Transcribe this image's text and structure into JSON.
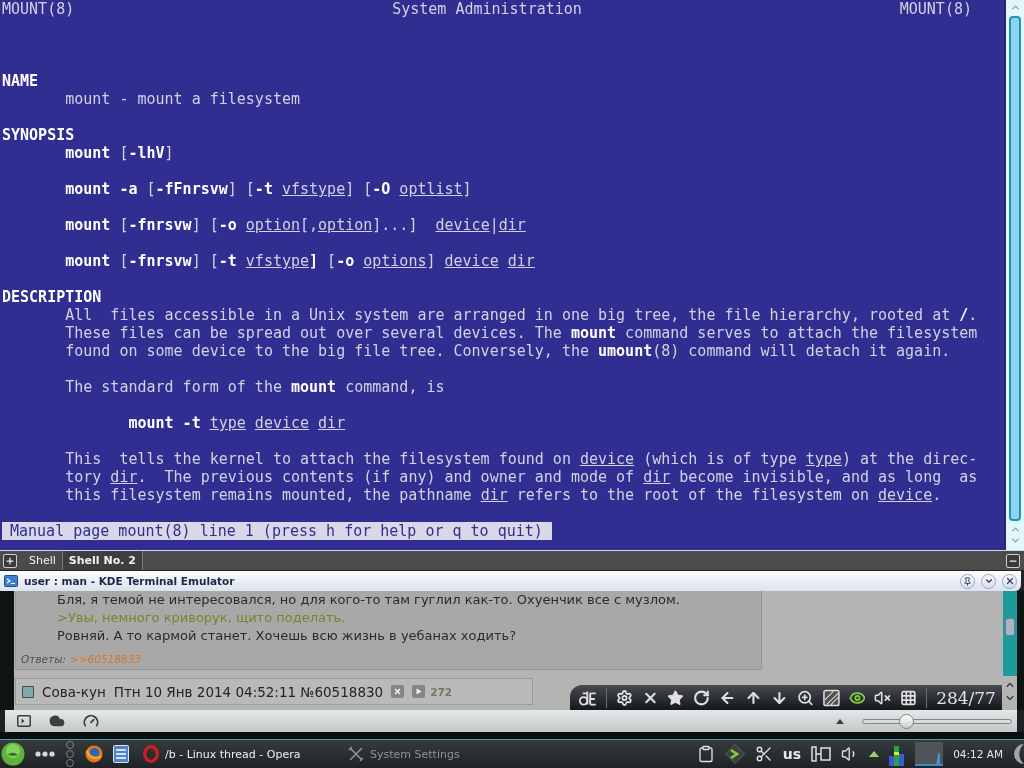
{
  "terminal": {
    "header": {
      "left": "MOUNT(8)",
      "center": "System Administration",
      "right": "MOUNT(8)"
    },
    "sections": [
      {
        "title": "NAME",
        "paragraphs": [
          {
            "kind": "text",
            "lines": [
              [
                {
                  "text": "mount - mount a filesystem",
                  "kind": "normal"
                }
              ]
            ]
          }
        ]
      },
      {
        "title": "SYNOPSIS",
        "paragraphs": [
          {
            "kind": "text",
            "lines": [
              [
                {
                  "text": "mount",
                  "kind": "bold"
                },
                {
                  "text": " [",
                  "kind": "normal"
                },
                {
                  "text": "-lhV",
                  "kind": "bold"
                },
                {
                  "text": "]",
                  "kind": "normal"
                }
              ]
            ]
          },
          {
            "kind": "text",
            "lines": [
              [
                {
                  "text": "mount -a",
                  "kind": "bold"
                },
                {
                  "text": " [",
                  "kind": "normal"
                },
                {
                  "text": "-fFnrsvw",
                  "kind": "bold"
                },
                {
                  "text": "] [",
                  "kind": "normal"
                },
                {
                  "text": "-t ",
                  "kind": "bold"
                },
                {
                  "text": "vfstype",
                  "kind": "underline"
                },
                {
                  "text": "] [",
                  "kind": "normal"
                },
                {
                  "text": "-O ",
                  "kind": "bold"
                },
                {
                  "text": "optlist",
                  "kind": "underline"
                },
                {
                  "text": "]",
                  "kind": "normal"
                }
              ]
            ]
          },
          {
            "kind": "text",
            "lines": [
              [
                {
                  "text": "mount",
                  "kind": "bold"
                },
                {
                  "text": " [",
                  "kind": "normal"
                },
                {
                  "text": "-fnrsvw",
                  "kind": "bold"
                },
                {
                  "text": "] [",
                  "kind": "normal"
                },
                {
                  "text": "-o ",
                  "kind": "bold"
                },
                {
                  "text": "option",
                  "kind": "underline"
                },
                {
                  "text": "[,",
                  "kind": "normal"
                },
                {
                  "text": "option",
                  "kind": "underline"
                },
                {
                  "text": "]...]  ",
                  "kind": "normal"
                },
                {
                  "text": "device",
                  "kind": "underline"
                },
                {
                  "text": "|",
                  "kind": "normal"
                },
                {
                  "text": "dir",
                  "kind": "underline"
                }
              ]
            ]
          },
          {
            "kind": "text",
            "lines": [
              [
                {
                  "text": "mount",
                  "kind": "bold"
                },
                {
                  "text": " [",
                  "kind": "normal"
                },
                {
                  "text": "-fnrsvw",
                  "kind": "bold"
                },
                {
                  "text": "] [",
                  "kind": "normal"
                },
                {
                  "text": "-t ",
                  "kind": "bold"
                },
                {
                  "text": "vfstype",
                  "kind": "underline"
                },
                {
                  "text": "]",
                  "kind": "bold"
                },
                {
                  "text": " [",
                  "kind": "normal"
                },
                {
                  "text": "-o ",
                  "kind": "bold"
                },
                {
                  "text": "options",
                  "kind": "underline"
                },
                {
                  "text": "] ",
                  "kind": "normal"
                },
                {
                  "text": "device dir",
                  "kind": "underline"
                }
              ]
            ]
          }
        ]
      },
      {
        "title": "DESCRIPTION",
        "paragraphs": [
          {
            "kind": "text",
            "lines": [
              [
                {
                  "text": "All  files accessible in a Unix system are arranged in one big tree, the file hierarchy, rooted at ",
                  "kind": "normal"
                },
                {
                  "text": "/",
                  "kind": "bold"
                },
                {
                  "text": ".",
                  "kind": "normal"
                }
              ],
              [
                {
                  "text": "These files can be spread out over several devices. The ",
                  "kind": "normal"
                },
                {
                  "text": "mount",
                  "kind": "bold"
                },
                {
                  "text": " command serves to attach the filesystem",
                  "kind": "normal"
                }
              ],
              [
                {
                  "text": "found on some device to the big file tree. Conversely, the ",
                  "kind": "normal"
                },
                {
                  "text": "umount",
                  "kind": "bold"
                },
                {
                  "text": "(8) command will detach it again.",
                  "kind": "normal"
                }
              ]
            ]
          },
          {
            "kind": "text",
            "lines": [
              [
                {
                  "text": "The standard form of the ",
                  "kind": "normal"
                },
                {
                  "text": "mount",
                  "kind": "bold"
                },
                {
                  "text": " command, is",
                  "kind": "normal"
                }
              ]
            ]
          },
          {
            "kind": "example",
            "lines": [
              [
                {
                  "text": "mount -t ",
                  "kind": "bold"
                },
                {
                  "text": "type device dir",
                  "kind": "underline"
                }
              ]
            ]
          },
          {
            "kind": "text",
            "lines": [
              [
                {
                  "text": "This  tells the kernel to attach the filesystem found on ",
                  "kind": "normal"
                },
                {
                  "text": "device",
                  "kind": "underline"
                },
                {
                  "text": " (which is of type ",
                  "kind": "normal"
                },
                {
                  "text": "type",
                  "kind": "underline"
                },
                {
                  "text": ") at the direc-",
                  "kind": "normal"
                }
              ],
              [
                {
                  "text": "tory ",
                  "kind": "normal"
                },
                {
                  "text": "dir",
                  "kind": "underline"
                },
                {
                  "text": ".  The previous contents (if any) and owner and mode of ",
                  "kind": "normal"
                },
                {
                  "text": "dir",
                  "kind": "underline"
                },
                {
                  "text": " become invisible, and as long  as",
                  "kind": "normal"
                }
              ],
              [
                {
                  "text": "this filesystem remains mounted, the pathname ",
                  "kind": "normal"
                },
                {
                  "text": "dir",
                  "kind": "underline"
                },
                {
                  "text": " refers to the root of the filesystem on ",
                  "kind": "normal"
                },
                {
                  "text": "device",
                  "kind": "underline"
                },
                {
                  "text": ".",
                  "kind": "normal"
                }
              ]
            ]
          }
        ]
      }
    ],
    "status": "Manual page mount(8) line 1 (press h for help or q to quit)"
  },
  "terminal_tabs": [
    {
      "label": "Shell",
      "selected": false
    },
    {
      "label": "Shell No. 2",
      "selected": true
    }
  ],
  "window": {
    "title": "user : man - KDE Terminal Emulator"
  },
  "browser": {
    "post": {
      "lines": [
        {
          "kind": "text",
          "text": "Бля, я темой не интересовался, но для кого-то там гуглил как-то. Охуенчик все с музлом."
        },
        {
          "kind": "quote",
          "text": ">Увы, немного криворук, щито поделать."
        },
        {
          "kind": "text",
          "text": "Ровняй. А то кармой станет. Хочешь всю жизнь в уебанах ходить?"
        }
      ],
      "replies_label": "Ответы:",
      "reply_link": ">>60518833"
    },
    "next_post": {
      "checked": false,
      "name": "Сова-кун",
      "date": "Птн 10 Янв 2014 04:52:11 №60518830",
      "number": "272"
    },
    "viewer_toolbar": {
      "counter": "284/77"
    },
    "zoom": {
      "level": 0.29
    }
  },
  "taskbar": {
    "tasks": [
      {
        "kind": "opera",
        "label": "/b - Linux thread - Opera",
        "active": true
      },
      {
        "kind": "settings",
        "label": "System Settings",
        "active": false
      }
    ],
    "keyboard_layout": "us",
    "clock": "04:12 AM"
  }
}
